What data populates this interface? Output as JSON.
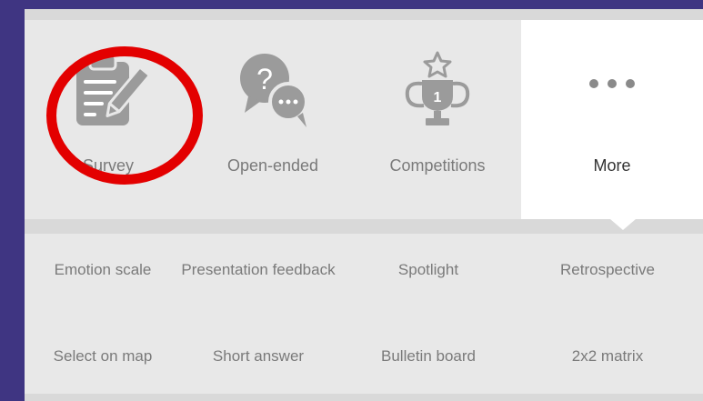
{
  "tiles": [
    {
      "label": "Survey",
      "icon": "survey-clipboard-icon"
    },
    {
      "label": "Open-ended",
      "icon": "speech-bubbles-icon"
    },
    {
      "label": "Competitions",
      "icon": "trophy-icon"
    },
    {
      "label": "More",
      "icon": "more-dots-icon"
    }
  ],
  "more_options": [
    [
      "Emotion scale",
      "Presentation feedback",
      "Spotlight",
      "Retrospective"
    ],
    [
      "Select on map",
      "Short answer",
      "Bulletin board",
      "2x2 matrix"
    ]
  ],
  "colors": {
    "background": "#3f3582",
    "panel": "#d9d9d9",
    "tile": "#e8e8e8",
    "selected_tile": "#ffffff",
    "highlight_ring": "#e30000",
    "icon_gray": "#9b9b9b"
  }
}
